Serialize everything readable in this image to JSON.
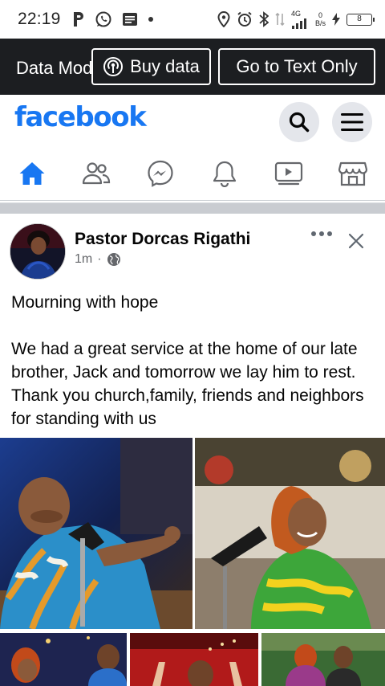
{
  "status_bar": {
    "time": "22:19",
    "network_type": "4G",
    "speed_value": "0",
    "speed_unit": "B/s",
    "battery": "8"
  },
  "data_banner": {
    "label": "Data Mode",
    "buy_data_label": "Buy data",
    "text_only_label": "Go to Text Only"
  },
  "header": {
    "logo": "facebook",
    "brand_color": "#1877f2"
  },
  "nav": {
    "tabs": [
      {
        "name": "home",
        "icon": "home-icon",
        "active": true
      },
      {
        "name": "friends",
        "icon": "friends-icon"
      },
      {
        "name": "messenger",
        "icon": "messenger-icon"
      },
      {
        "name": "notifications",
        "icon": "bell-icon"
      },
      {
        "name": "watch",
        "icon": "video-icon"
      },
      {
        "name": "marketplace",
        "icon": "store-icon"
      }
    ]
  },
  "post": {
    "author": "Pastor Dorcas Rigathi",
    "time": "1m",
    "separator": "·",
    "privacy_icon": "globe-icon",
    "text_line1": "Mourning with hope",
    "text_para": "We had a great service at the home of our late brother, Jack and tomorrow we lay him to rest. Thank you church,family, friends and neighbors for standing with us"
  }
}
